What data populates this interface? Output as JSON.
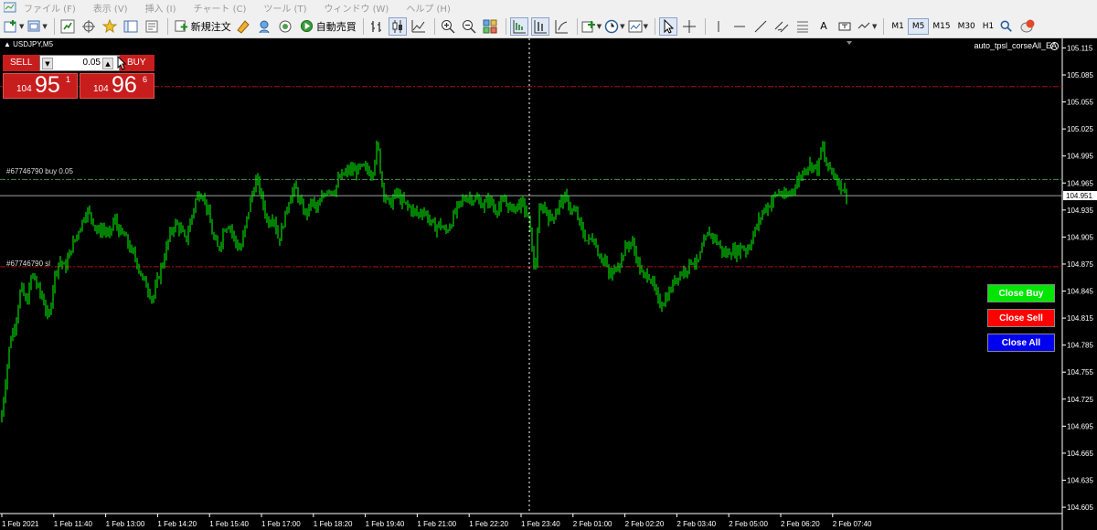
{
  "menu": {
    "items": [
      "ファイル (F)",
      "表示 (V)",
      "挿入 (I)",
      "チャート (C)",
      "ツール (T)",
      "ウィンドウ (W)",
      "ヘルプ (H)"
    ]
  },
  "toolbar": {
    "new_order_label": "新規注文",
    "auto_trading_label": "自動売買",
    "timeframes": [
      "M1",
      "M5",
      "M15",
      "M30",
      "H1"
    ],
    "active_timeframe": "M5",
    "text_tool_label": "A"
  },
  "chart": {
    "symbol_label": "USDJPY,M5",
    "ea_label": "auto_tpsl_corseAll_EA",
    "order_buy_label": "#67746790 buy 0.05",
    "order_sl_label": "#67746790 sl",
    "current_price": "104.951",
    "colors": {
      "background": "#000000",
      "candle": "#00ff00",
      "order_line": "#4a8f4a",
      "sl_line": "#b01010",
      "tp_line": "#b01010",
      "bid_line": "#a0a0a0",
      "price_tag_bg": "#ffffff"
    }
  },
  "trade_panel": {
    "sell_label": "SELL",
    "buy_label": "BUY",
    "lot_value": "0.05",
    "sell_price": {
      "small": "104",
      "big": "95",
      "sup": "1"
    },
    "buy_price": {
      "small": "104",
      "big": "96",
      "sup": "6"
    }
  },
  "buttons": {
    "close_buy": "Close Buy",
    "close_sell": "Close Sell",
    "close_all": "Close All"
  },
  "chart_data": {
    "type": "candlestick",
    "symbol": "USDJPY",
    "timeframe": "M5",
    "y_ticks": [
      "105.115",
      "105.085",
      "105.055",
      "105.025",
      "104.995",
      "104.965",
      "104.935",
      "104.905",
      "104.875",
      "104.845",
      "104.815",
      "104.785",
      "104.755",
      "104.725",
      "104.695",
      "104.665",
      "104.635",
      "104.605"
    ],
    "ylim": [
      104.6,
      105.12
    ],
    "x_ticks": [
      "1 Feb 2021",
      "1 Feb 11:40",
      "1 Feb 13:00",
      "1 Feb 14:20",
      "1 Feb 15:40",
      "1 Feb 17:00",
      "1 Feb 18:20",
      "1 Feb 19:40",
      "1 Feb 21:00",
      "1 Feb 22:20",
      "1 Feb 23:40",
      "2 Feb 01:00",
      "2 Feb 02:20",
      "2 Feb 03:40",
      "2 Feb 05:00",
      "2 Feb 06:20",
      "2 Feb 07:40"
    ],
    "horizontal_lines": [
      {
        "name": "tp",
        "price": 105.072,
        "style": "dashdot"
      },
      {
        "name": "buy-order",
        "price": 104.969,
        "style": "dashdot"
      },
      {
        "name": "bid",
        "price": 104.951,
        "style": "solid"
      },
      {
        "name": "sl",
        "price": 104.872,
        "style": "dashdot"
      }
    ],
    "crosshair_x_label": "1 Feb 23:40",
    "price_path": [
      [
        0,
        104.7
      ],
      [
        5,
        104.745
      ],
      [
        10,
        104.79
      ],
      [
        16,
        104.81
      ],
      [
        22,
        104.85
      ],
      [
        28,
        104.83
      ],
      [
        34,
        104.865
      ],
      [
        40,
        104.85
      ],
      [
        48,
        104.83
      ],
      [
        52,
        104.81
      ],
      [
        58,
        104.86
      ],
      [
        64,
        104.88
      ],
      [
        70,
        104.87
      ],
      [
        76,
        104.89
      ],
      [
        82,
        104.905
      ],
      [
        88,
        104.92
      ],
      [
        94,
        104.935
      ],
      [
        100,
        104.925
      ],
      [
        106,
        104.91
      ],
      [
        112,
        104.915
      ],
      [
        118,
        104.905
      ],
      [
        124,
        104.925
      ],
      [
        130,
        104.91
      ],
      [
        136,
        104.905
      ],
      [
        142,
        104.89
      ],
      [
        148,
        104.88
      ],
      [
        154,
        104.86
      ],
      [
        160,
        104.85
      ],
      [
        166,
        104.835
      ],
      [
        172,
        104.86
      ],
      [
        178,
        104.88
      ],
      [
        184,
        104.905
      ],
      [
        190,
        104.92
      ],
      [
        196,
        104.915
      ],
      [
        202,
        104.9
      ],
      [
        208,
        104.925
      ],
      [
        214,
        104.95
      ],
      [
        220,
        104.955
      ],
      [
        226,
        104.935
      ],
      [
        232,
        104.905
      ],
      [
        238,
        104.89
      ],
      [
        244,
        104.915
      ],
      [
        250,
        104.92
      ],
      [
        256,
        104.9
      ],
      [
        262,
        104.89
      ],
      [
        268,
        104.92
      ],
      [
        274,
        104.95
      ],
      [
        280,
        104.97
      ],
      [
        286,
        104.945
      ],
      [
        292,
        104.92
      ],
      [
        298,
        104.93
      ],
      [
        304,
        104.9
      ],
      [
        310,
        104.925
      ],
      [
        316,
        104.95
      ],
      [
        322,
        104.96
      ],
      [
        328,
        104.94
      ],
      [
        334,
        104.93
      ],
      [
        340,
        104.945
      ],
      [
        346,
        104.935
      ],
      [
        352,
        104.95
      ],
      [
        358,
        104.96
      ],
      [
        364,
        104.955
      ],
      [
        370,
        104.97
      ],
      [
        376,
        104.975
      ],
      [
        382,
        104.98
      ],
      [
        388,
        104.978
      ],
      [
        394,
        104.982
      ],
      [
        400,
        104.98
      ],
      [
        406,
        104.975
      ],
      [
        412,
        105.01
      ],
      [
        416,
        104.97
      ],
      [
        420,
        104.95
      ],
      [
        426,
        104.94
      ],
      [
        432,
        104.955
      ],
      [
        438,
        104.945
      ],
      [
        444,
        104.94
      ],
      [
        450,
        104.935
      ],
      [
        456,
        104.93
      ],
      [
        462,
        104.935
      ],
      [
        468,
        104.925
      ],
      [
        474,
        104.915
      ],
      [
        480,
        104.92
      ],
      [
        486,
        104.91
      ],
      [
        492,
        104.92
      ],
      [
        498,
        104.935
      ],
      [
        504,
        104.945
      ],
      [
        510,
        104.95
      ],
      [
        516,
        104.948
      ],
      [
        522,
        104.945
      ],
      [
        528,
        104.94
      ],
      [
        534,
        104.948
      ],
      [
        540,
        104.935
      ],
      [
        546,
        104.94
      ],
      [
        552,
        104.945
      ],
      [
        558,
        104.935
      ],
      [
        564,
        104.94
      ],
      [
        570,
        104.942
      ],
      [
        576,
        104.93
      ],
      [
        580,
        104.905
      ],
      [
        584,
        104.86
      ],
      [
        588,
        104.93
      ],
      [
        594,
        104.94
      ],
      [
        600,
        104.925
      ],
      [
        606,
        104.93
      ],
      [
        612,
        104.945
      ],
      [
        618,
        104.948
      ],
      [
        624,
        104.935
      ],
      [
        630,
        104.93
      ],
      [
        636,
        104.91
      ],
      [
        642,
        104.9
      ],
      [
        648,
        104.905
      ],
      [
        654,
        104.885
      ],
      [
        660,
        104.88
      ],
      [
        666,
        104.86
      ],
      [
        672,
        104.87
      ],
      [
        678,
        104.88
      ],
      [
        684,
        104.895
      ],
      [
        690,
        104.9
      ],
      [
        696,
        104.88
      ],
      [
        702,
        104.86
      ],
      [
        708,
        104.865
      ],
      [
        714,
        104.85
      ],
      [
        720,
        104.83
      ],
      [
        726,
        104.835
      ],
      [
        732,
        104.845
      ],
      [
        738,
        104.86
      ],
      [
        744,
        104.865
      ],
      [
        750,
        104.87
      ],
      [
        756,
        104.88
      ],
      [
        762,
        104.875
      ],
      [
        768,
        104.895
      ],
      [
        774,
        104.91
      ],
      [
        780,
        104.905
      ],
      [
        786,
        104.895
      ],
      [
        792,
        104.885
      ],
      [
        798,
        104.89
      ],
      [
        804,
        104.888
      ],
      [
        810,
        104.895
      ],
      [
        816,
        104.89
      ],
      [
        822,
        104.905
      ],
      [
        828,
        104.92
      ],
      [
        834,
        104.935
      ],
      [
        840,
        104.94
      ],
      [
        846,
        104.95
      ],
      [
        852,
        104.955
      ],
      [
        858,
        104.948
      ],
      [
        864,
        104.955
      ],
      [
        870,
        104.965
      ],
      [
        876,
        104.975
      ],
      [
        882,
        104.985
      ],
      [
        888,
        104.985
      ],
      [
        894,
        104.98
      ],
      [
        898,
        105.01
      ],
      [
        902,
        104.985
      ],
      [
        908,
        104.98
      ],
      [
        914,
        104.97
      ],
      [
        920,
        104.96
      ],
      [
        926,
        104.951
      ]
    ]
  }
}
